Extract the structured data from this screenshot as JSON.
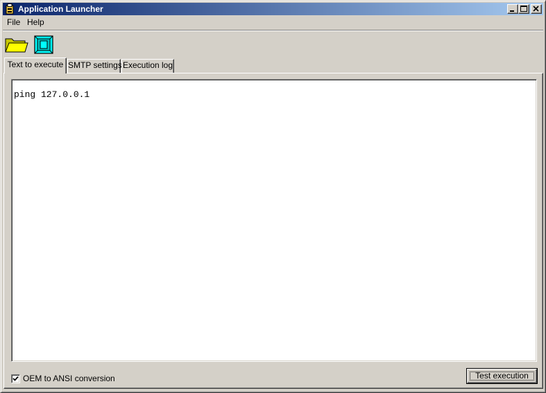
{
  "window": {
    "title": "Application Launcher"
  },
  "menu": {
    "items": [
      "File",
      "Help"
    ]
  },
  "toolbar": {
    "icons": [
      "open-folder-icon",
      "execute-window-icon"
    ]
  },
  "tabs": [
    {
      "label": "Text to execute",
      "active": true
    },
    {
      "label": "SMTP settings",
      "active": false
    },
    {
      "label": "Execution log",
      "active": false
    }
  ],
  "editor": {
    "value": "ping 127.0.0.1"
  },
  "options": {
    "oem_label": "OEM to ANSI conversion",
    "oem_checked": true
  },
  "actions": {
    "test_label": "Test execution"
  },
  "colors": {
    "title_gradient_start": "#0a246a",
    "title_gradient_end": "#a6caf0",
    "face": "#d4d0c8",
    "folder_yellow": "#ffff00",
    "window_icon_cyan": "#00ffff"
  }
}
